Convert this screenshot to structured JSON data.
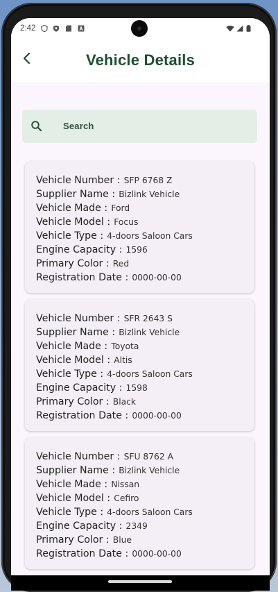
{
  "status_bar": {
    "time": "2:42",
    "left_icons": [
      "shield-icon",
      "shield-filled-icon",
      "sd-card-icon",
      "a-badge-icon"
    ],
    "right_icons": [
      "wifi-icon",
      "signal-icon",
      "battery-icon"
    ]
  },
  "app_bar": {
    "title": "Vehicle Details",
    "back_icon": "chevron-left-icon",
    "title_color": "#1d4f31"
  },
  "search": {
    "placeholder": "Search",
    "icon": "search-icon",
    "background": "#e3eee7"
  },
  "field_labels": {
    "vehicle_number": "Vehicle Number :",
    "supplier_name": "Supplier Name :",
    "vehicle_made": "Vehicle Made :",
    "vehicle_model": "Vehicle Model :",
    "vehicle_type": "Vehicle Type :",
    "engine_capacity": "Engine Capacity :",
    "primary_color": "Primary Color :",
    "registration_date": "Registration Date :"
  },
  "vehicles": [
    {
      "vehicle_number": "SFP 6768 Z",
      "supplier_name": "Bizlink Vehicle",
      "vehicle_made": "Ford",
      "vehicle_model": "Focus",
      "vehicle_type": "4-doors Saloon Cars",
      "engine_capacity": "1596",
      "primary_color": "Red",
      "registration_date": "0000-00-00"
    },
    {
      "vehicle_number": "SFR 2643 S",
      "supplier_name": "Bizlink Vehicle",
      "vehicle_made": "Toyota",
      "vehicle_model": "Altis",
      "vehicle_type": "4-doors Saloon Cars",
      "engine_capacity": "1598",
      "primary_color": "Black",
      "registration_date": "0000-00-00"
    },
    {
      "vehicle_number": "SFU 8762 A",
      "supplier_name": "Bizlink Vehicle",
      "vehicle_made": "Nissan",
      "vehicle_model": "Cefiro",
      "vehicle_type": "4-doors Saloon Cars",
      "engine_capacity": "2349",
      "primary_color": "Blue",
      "registration_date": "0000-00-00"
    }
  ],
  "colors": {
    "content_background": "#fbf6fd",
    "card_background": "#f4eff6"
  }
}
